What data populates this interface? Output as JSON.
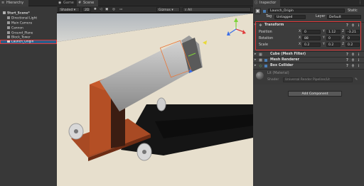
{
  "hierarchy": {
    "tab_label": "Hierarchy",
    "items": [
      {
        "label": "Start_Scene*"
      },
      {
        "label": "Directional Light"
      },
      {
        "label": "Main Camera"
      },
      {
        "label": "Cannon"
      },
      {
        "label": "Ground_Plane"
      },
      {
        "label": "Block_Tower"
      },
      {
        "label": "Launch_Origin"
      }
    ]
  },
  "scene": {
    "tabs": [
      {
        "label": "Game"
      },
      {
        "label": "Scene"
      }
    ],
    "toolbar": {
      "shading": "Shaded",
      "mode_2d": "2D",
      "gizmos": "Gizmos",
      "all_search": "All"
    }
  },
  "inspector": {
    "tab_label": "Inspector",
    "object_name": "Launch_Origin",
    "static_label": "Static",
    "tag_label": "Tag",
    "tag_value": "Untagged",
    "layer_label": "Layer",
    "layer_value": "Default",
    "transform": {
      "title": "Transform",
      "rows": [
        {
          "label": "Position",
          "x": "0",
          "y": "1.12",
          "z": "-3.21"
        },
        {
          "label": "Rotation",
          "x": "88",
          "y": "0",
          "z": "0"
        },
        {
          "label": "Scale",
          "x": "0.2",
          "y": "0.2",
          "z": "0.2"
        }
      ]
    },
    "components": [
      {
        "label": "Cube (Mesh Filter)"
      },
      {
        "label": "Mesh Renderer"
      },
      {
        "label": "Box Collider"
      }
    ],
    "material": {
      "name": "Lit (Material)",
      "shader_label": "Shader",
      "shader_value": "Universal Render Pipeline/Lit"
    },
    "add_component_label": "Add Component"
  }
}
